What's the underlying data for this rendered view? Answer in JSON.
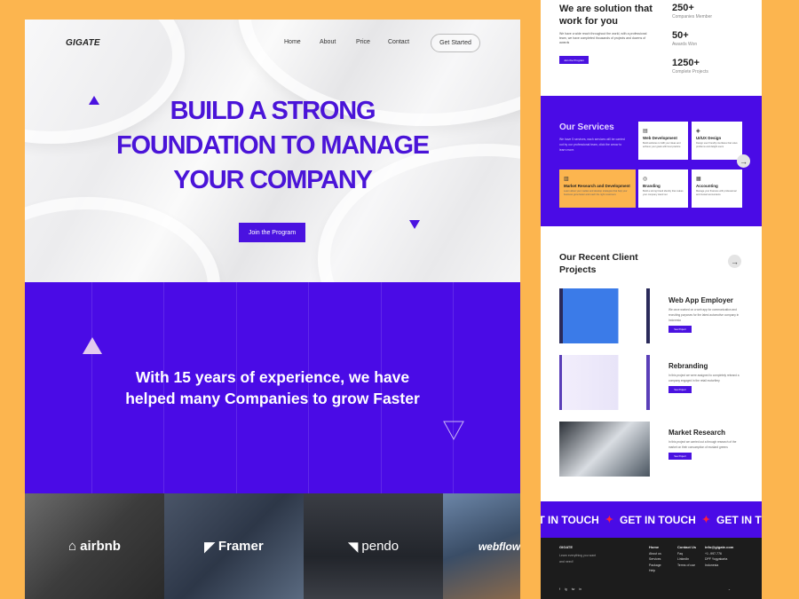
{
  "header": {
    "logo": "GIGATE",
    "nav": [
      "Home",
      "About",
      "Price",
      "Contact"
    ],
    "cta": "Get Started"
  },
  "hero": {
    "headline": [
      "BUILD A STRONG",
      "FOUNDATION TO MANAGE",
      "YOUR COMPANY"
    ],
    "button": "Join the Program"
  },
  "experience": {
    "text_line1": "With 15 years of experience, we have",
    "text_line2": "helped many Companies to grow Faster"
  },
  "partners": [
    "airbnb",
    "Framer",
    "pendo",
    "webflow"
  ],
  "solution": {
    "title": "We are solution that work for you",
    "description": "We have a wide reach throughout the world, with a professional team, we have completed thousands of projects and dozens of awards",
    "button": "Join the Program",
    "stats": [
      {
        "value": "250+",
        "label": "Companies Member"
      },
      {
        "value": "50+",
        "label": "Awards Won"
      },
      {
        "value": "1250+",
        "label": "Complete Projects"
      }
    ]
  },
  "services": {
    "title": "Our Services",
    "description": "We have 5 services, each services will be carried out by our professional team, click the arrow to learn more.",
    "cards": [
      {
        "title": "Web Development",
        "icon": "code-icon",
        "description": "Build websites to fulfil your ideas and achieve your goals with best practice"
      },
      {
        "title": "UI/UX Design",
        "icon": "design-icon",
        "description": "Design user friendly interfaces that solve problems and delight users"
      },
      {
        "title": "Market Research and Development",
        "icon": "chart-icon",
        "description": "Learn about your market and develop strategies that help your business grow faster and reach the right customers"
      },
      {
        "title": "Branding",
        "icon": "target-icon",
        "description": "Build a strong brand identity that makes your company stand out"
      },
      {
        "title": "Accounting",
        "icon": "calculator-icon",
        "description": "Manage your finances with professional and trusted accountants"
      }
    ]
  },
  "projects": {
    "title": "Our Recent Client Projects",
    "items": [
      {
        "title": "Web App Employer",
        "description": "We once worked on a web app for communication and recruiting purposes for the latest automotive company in Indonesia",
        "button": "See Project"
      },
      {
        "title": "Rebranding",
        "description": "In this project we were assigned to completely rebrand a company engaged in the retail motorfiery",
        "button": "See Project"
      },
      {
        "title": "Market Research",
        "description": "In this project we carried out a through research of the market on their consumption of mustard greens",
        "button": "See Project"
      }
    ]
  },
  "touch": {
    "text": "GET IN TOUCH"
  },
  "footer": {
    "logo": "GIGATE",
    "tagline": "Learn everything you want and need!",
    "col1": {
      "heading": "Home",
      "links": [
        "About us",
        "Services",
        "Package",
        "Help"
      ]
    },
    "col2": {
      "heading": "Contact Us",
      "links": [
        "Faq",
        "LinkedIn",
        "Terms of use"
      ]
    },
    "col3": {
      "heading": "info@gigate.com",
      "links": [
        "+1 -997-776",
        "DPF Yogyakarta",
        "Indonesia"
      ]
    },
    "social": [
      "f",
      "ig",
      "tw",
      "in"
    ]
  },
  "colors": {
    "primary": "#4a0be6",
    "accent": "#fcb54f",
    "star": "#ff1e3c"
  }
}
